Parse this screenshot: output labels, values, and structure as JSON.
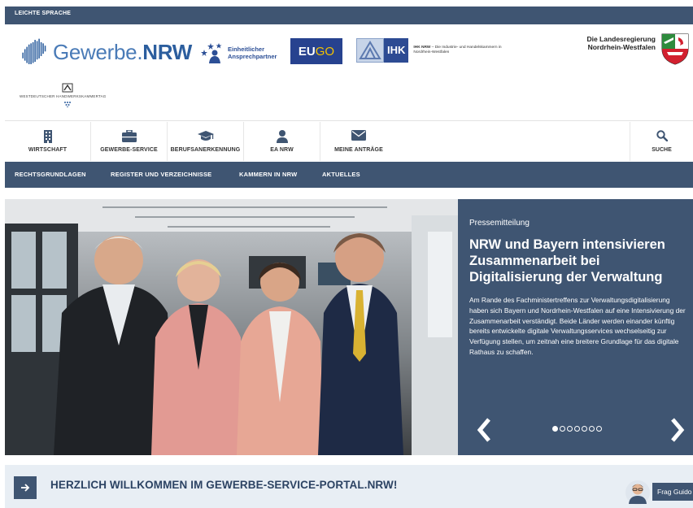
{
  "topbar": {
    "leichte_sprache": "LEICHTE SPRACHE"
  },
  "logos": {
    "gewerbe_part1": "Gewerbe.",
    "gewerbe_part2": "NRW",
    "eap_line1": "Einheitlicher",
    "eap_line2": "Ansprechpartner",
    "eugo_part1": "EU",
    "eugo_part2": "GO",
    "ihk": "IHK",
    "ihk_small_bold": "IHK NRW",
    "ihk_small_text": "– Die Industrie- und Handelskammern in Nordrhein-Westfalen",
    "landes_line1": "Die Landesregierung",
    "landes_line2": "Nordrhein-Westfalen",
    "whkt": "WESTDEUTSCHER HANDWERKSKAMMERTAG"
  },
  "iconnav": {
    "items": [
      {
        "label": "WIRTSCHAFT",
        "icon": "building-icon"
      },
      {
        "label": "GEWERBE-SERVICE",
        "icon": "briefcase-icon"
      },
      {
        "label": "BERUFSANERKENNUNG",
        "icon": "graduation-cap-icon"
      },
      {
        "label": "EA NRW",
        "icon": "user-icon"
      },
      {
        "label": "MEINE ANTRÄGE",
        "icon": "envelope-icon"
      }
    ],
    "search_label": "SUCHE"
  },
  "mainnav": {
    "items": [
      "RECHTSGRUNDLAGEN",
      "REGISTER UND VERZEICHNISSE",
      "KAMMERN IN NRW",
      "AKTUELLES"
    ]
  },
  "hero": {
    "kicker": "Pressemitteilung",
    "headline": "NRW und Bayern intensivieren Zusammenarbeit bei Digitalisierung der Verwaltung",
    "body": "Am Rande des Fachministertreffens zur Verwaltungsdigitalisierung haben sich Bayern und Nordrhein-Westfalen auf eine Intensivierung der Zusammenarbeit verständigt. Beide Länder werden einander künftig bereits entwickelte digitale Verwaltungsservices wechselseitig zur Verfügung stellen, um zeitnah eine breitere Grundlage für das digitale Rathaus zu schaffen.",
    "slides_total": 7,
    "active_slide": 1
  },
  "welcome": {
    "title": "HERZLICH WILLKOMMEN IM GEWERBE-SERVICE-PORTAL.NRW!",
    "guido_label": "Frag Guido"
  },
  "colors": {
    "primary": "#3f5572",
    "accent_blue": "#2c5e9e",
    "welcome_bg": "#e8eef4"
  }
}
